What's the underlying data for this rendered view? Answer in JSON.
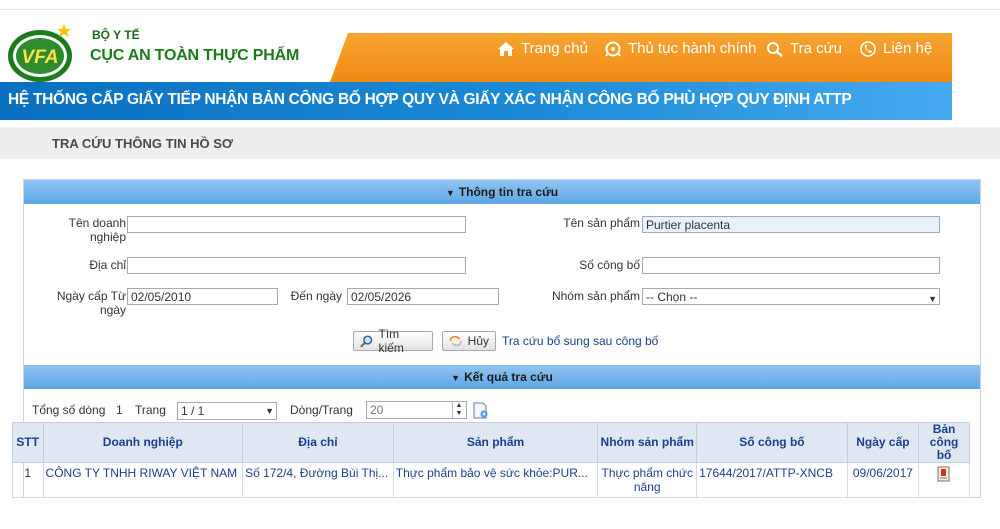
{
  "header": {
    "ministry": "BỘ Y TẾ",
    "agency": "CỤC AN TOÀN THỰC PHẨM",
    "logo_text": "VFA",
    "nav": [
      {
        "label": "Trang chủ",
        "icon": "home-icon"
      },
      {
        "label": "Thủ tục hành chính",
        "icon": "procedure-icon"
      },
      {
        "label": "Tra cứu",
        "icon": "search-icon"
      },
      {
        "label": "Liên hệ",
        "icon": "phone-icon"
      }
    ],
    "system_title": "HỆ THỐNG CẤP GIẤY TIẾP NHẬN BẢN CÔNG BỐ HỢP QUY VÀ GIẤY XÁC NHẬN CÔNG BỐ PHÙ HỢP QUY ĐỊNH ATTP"
  },
  "page_title": "TRA CỨU THÔNG TIN HỒ SƠ",
  "search": {
    "panel_title": "Thông tin tra cứu",
    "company_label": "Tên doanh nghiệp",
    "company_value": "",
    "product_label": "Tên sản phẩm",
    "product_value": "Purtier placenta",
    "address_label": "Địa chỉ",
    "address_value": "",
    "number_label": "Số công bố",
    "number_value": "",
    "from_label": "Ngày cấp Từ ngày",
    "from_value": "02/05/2010",
    "to_label": "Đến ngày",
    "to_value": "02/05/2026",
    "group_label": "Nhóm sản phẩm",
    "group_value": "-- Chọn --",
    "search_button": "Tìm kiếm",
    "cancel_button": "Hủy",
    "supplement_link": "Tra cứu bổ sung sau công bố"
  },
  "results": {
    "panel_title": "Kết quả tra cứu",
    "total_label": "Tổng số dòng",
    "total_value": "1",
    "page_label": "Trang",
    "page_value": "1 / 1",
    "rows_label": "Dòng/Trang",
    "rows_value": "20",
    "columns": [
      "STT",
      "Doanh nghiệp",
      "Địa chỉ",
      "Sản phẩm",
      "Nhóm sản phẩm",
      "Số công bố",
      "Ngày cấp",
      "Bản công bố"
    ],
    "rows": [
      {
        "stt": "1",
        "company": "CÔNG TY TNHH RIWAY VIỆT NAM",
        "address": "Số 172/4, Đường Bùi Thị...",
        "product": "Thực phẩm bảo vệ sức khỏe:PUR...",
        "group": "Thực phẩm chức năng",
        "number": "17644/2017/ATTP-XNCB",
        "date": "09/06/2017"
      }
    ]
  },
  "colors": {
    "orange": "#ef8a15",
    "blue": "#0a6fc0",
    "green": "#1b7a1b",
    "link": "#1b3f8f"
  }
}
